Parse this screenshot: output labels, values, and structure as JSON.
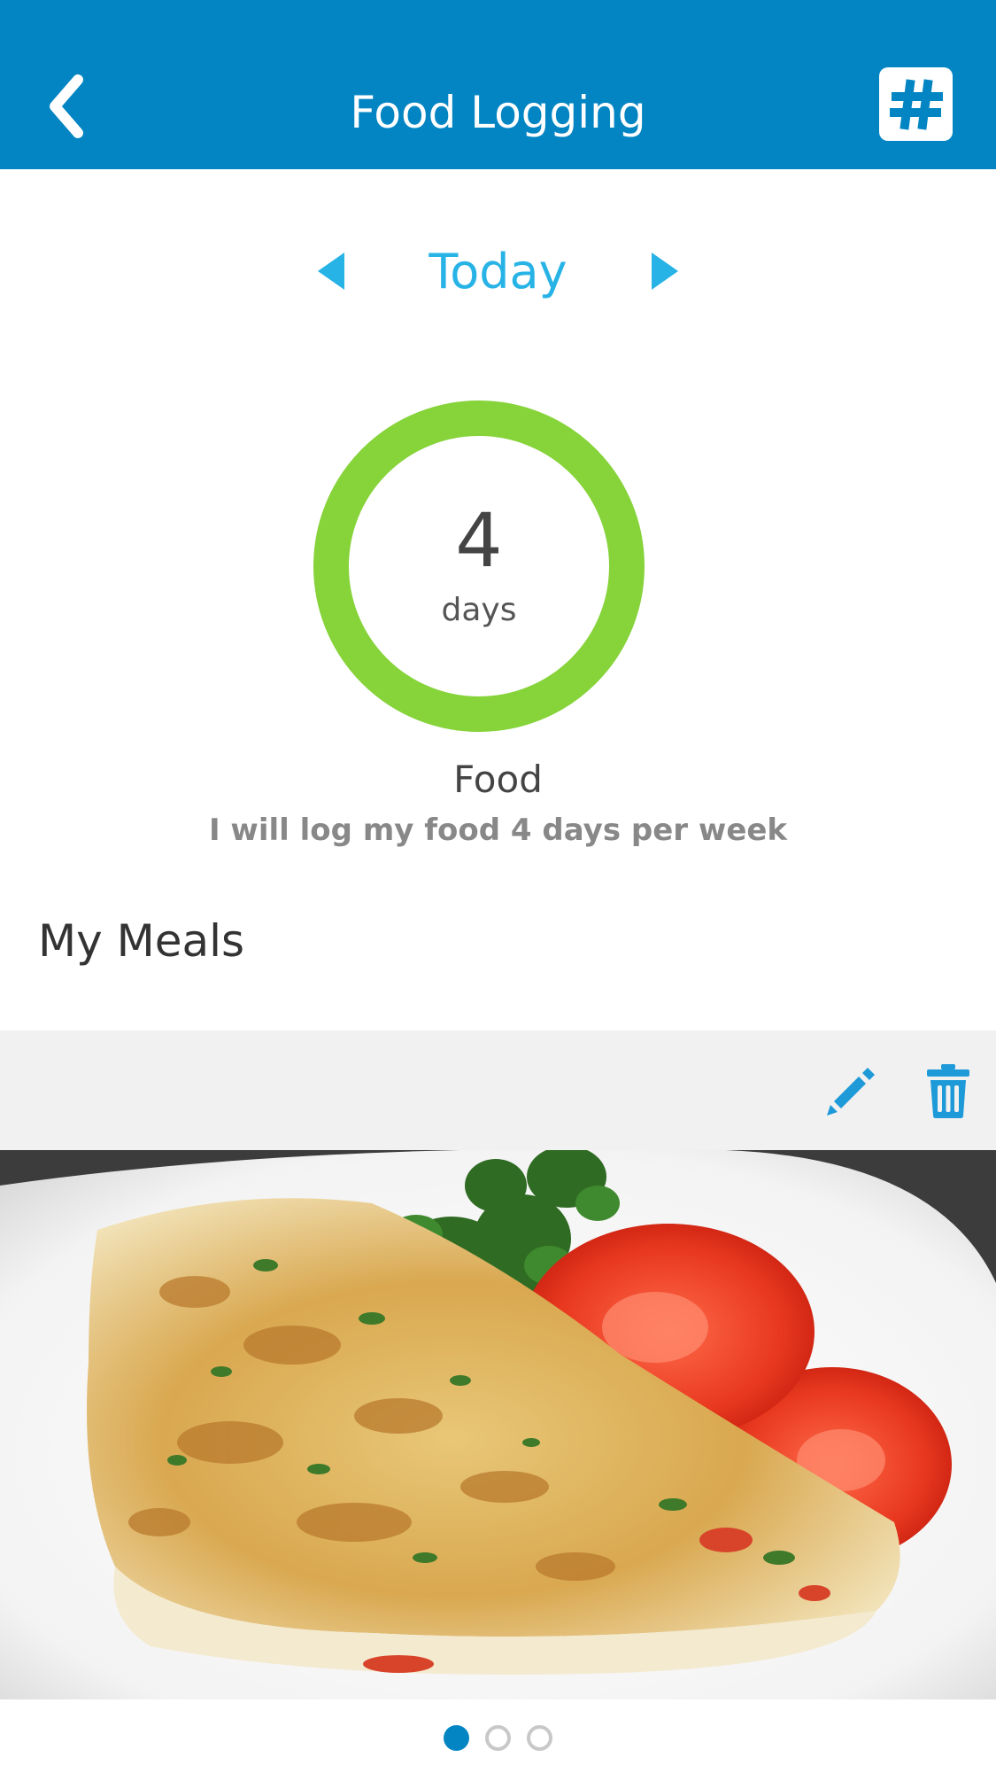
{
  "header": {
    "title": "Food Logging",
    "back_icon": "chevron-left-icon",
    "action_icon": "hashtag-icon",
    "background_color": "#0385c3"
  },
  "date_nav": {
    "label": "Today",
    "prev_icon": "triangle-left-icon",
    "next_icon": "triangle-right-icon",
    "accent_color": "#27b3e6"
  },
  "progress": {
    "value": "4",
    "unit": "days",
    "ring_color": "#86d33a"
  },
  "goal": {
    "title": "Food",
    "description": "I will log my food 4 days per week"
  },
  "meals": {
    "section_title": "My Meals",
    "edit_icon": "pencil-icon",
    "delete_icon": "trash-icon",
    "photo": "omelette-with-tomato-slices-and-parsley"
  },
  "pager": {
    "count": 3,
    "active_index": 0
  }
}
